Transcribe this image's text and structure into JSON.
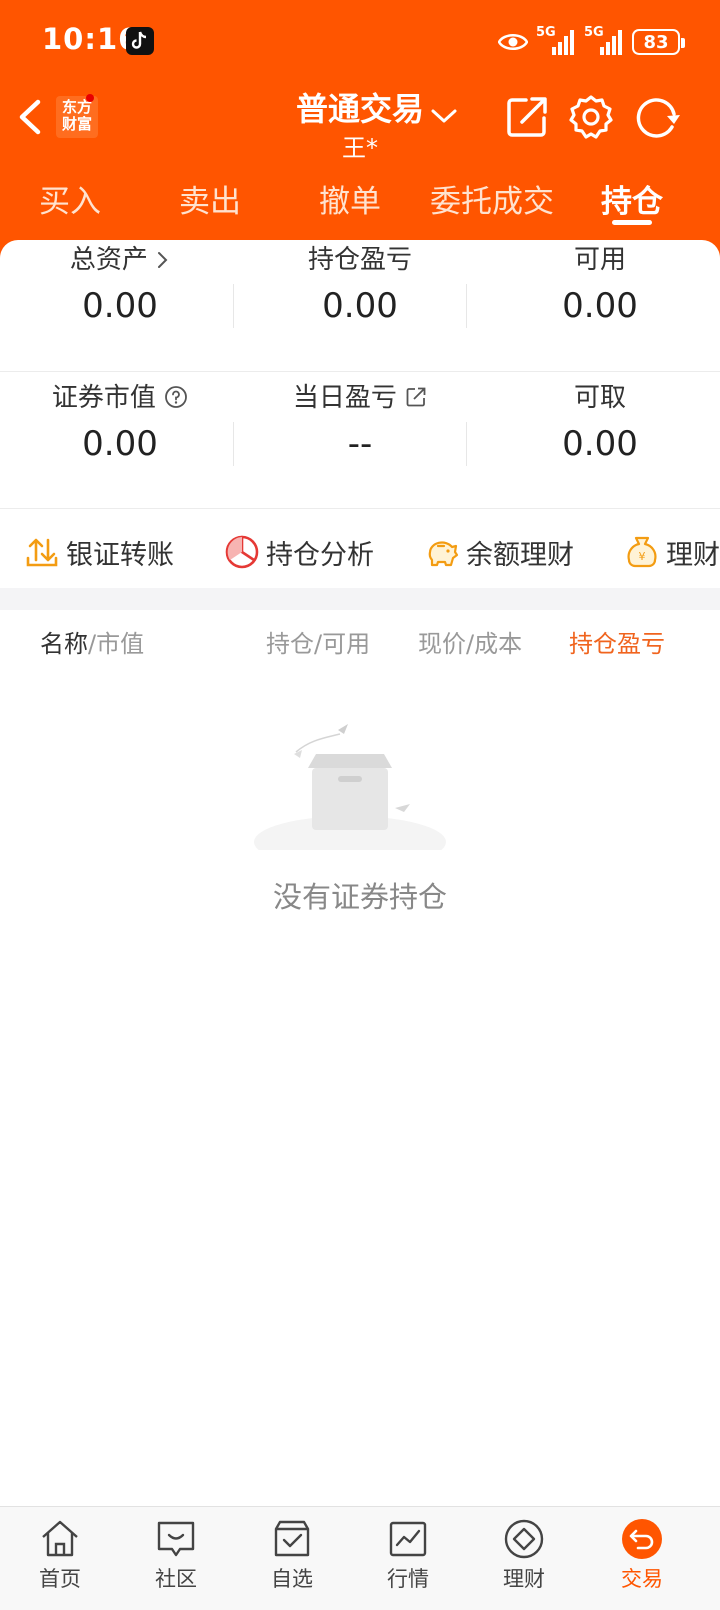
{
  "status_bar": {
    "time": "10:16",
    "network": "5G",
    "battery": "83"
  },
  "nav": {
    "logo_text": "东方财富",
    "title": "普通交易",
    "account": "王*"
  },
  "tabs": [
    {
      "label": "买入"
    },
    {
      "label": "卖出"
    },
    {
      "label": "撤单"
    },
    {
      "label": "委托成交"
    },
    {
      "label": "持仓",
      "active": true
    }
  ],
  "summary": {
    "total_assets": {
      "label": "总资产",
      "value": "0.00"
    },
    "position_pnl": {
      "label": "持仓盈亏",
      "value": "0.00"
    },
    "available": {
      "label": "可用",
      "value": "0.00"
    },
    "market_value": {
      "label": "证券市值",
      "value": "0.00"
    },
    "daily_pnl": {
      "label": "当日盈亏",
      "value": "--"
    },
    "withdrawable": {
      "label": "可取",
      "value": "0.00"
    }
  },
  "quick_actions": [
    {
      "label": "银证转账",
      "icon": "transfer-icon"
    },
    {
      "label": "持仓分析",
      "icon": "pie-chart-icon"
    },
    {
      "label": "余额理财",
      "icon": "piggy-bank-icon"
    },
    {
      "label": "理财",
      "icon": "money-bag-icon"
    }
  ],
  "table_header": {
    "name": "名称",
    "market_value": "/市值",
    "holding": "持仓/可用",
    "price": "现价/成本",
    "pnl": "持仓盈亏"
  },
  "empty_state": {
    "text": "没有证券持仓"
  },
  "bottom_nav": [
    {
      "label": "首页",
      "icon": "home-icon"
    },
    {
      "label": "社区",
      "icon": "community-icon"
    },
    {
      "label": "自选",
      "icon": "watchlist-icon"
    },
    {
      "label": "行情",
      "icon": "market-icon"
    },
    {
      "label": "理财",
      "icon": "wealth-icon"
    },
    {
      "label": "交易",
      "icon": "trade-icon",
      "active": true
    }
  ],
  "colors": {
    "brand": "#ff5500",
    "accent_text": "#f0641e"
  }
}
